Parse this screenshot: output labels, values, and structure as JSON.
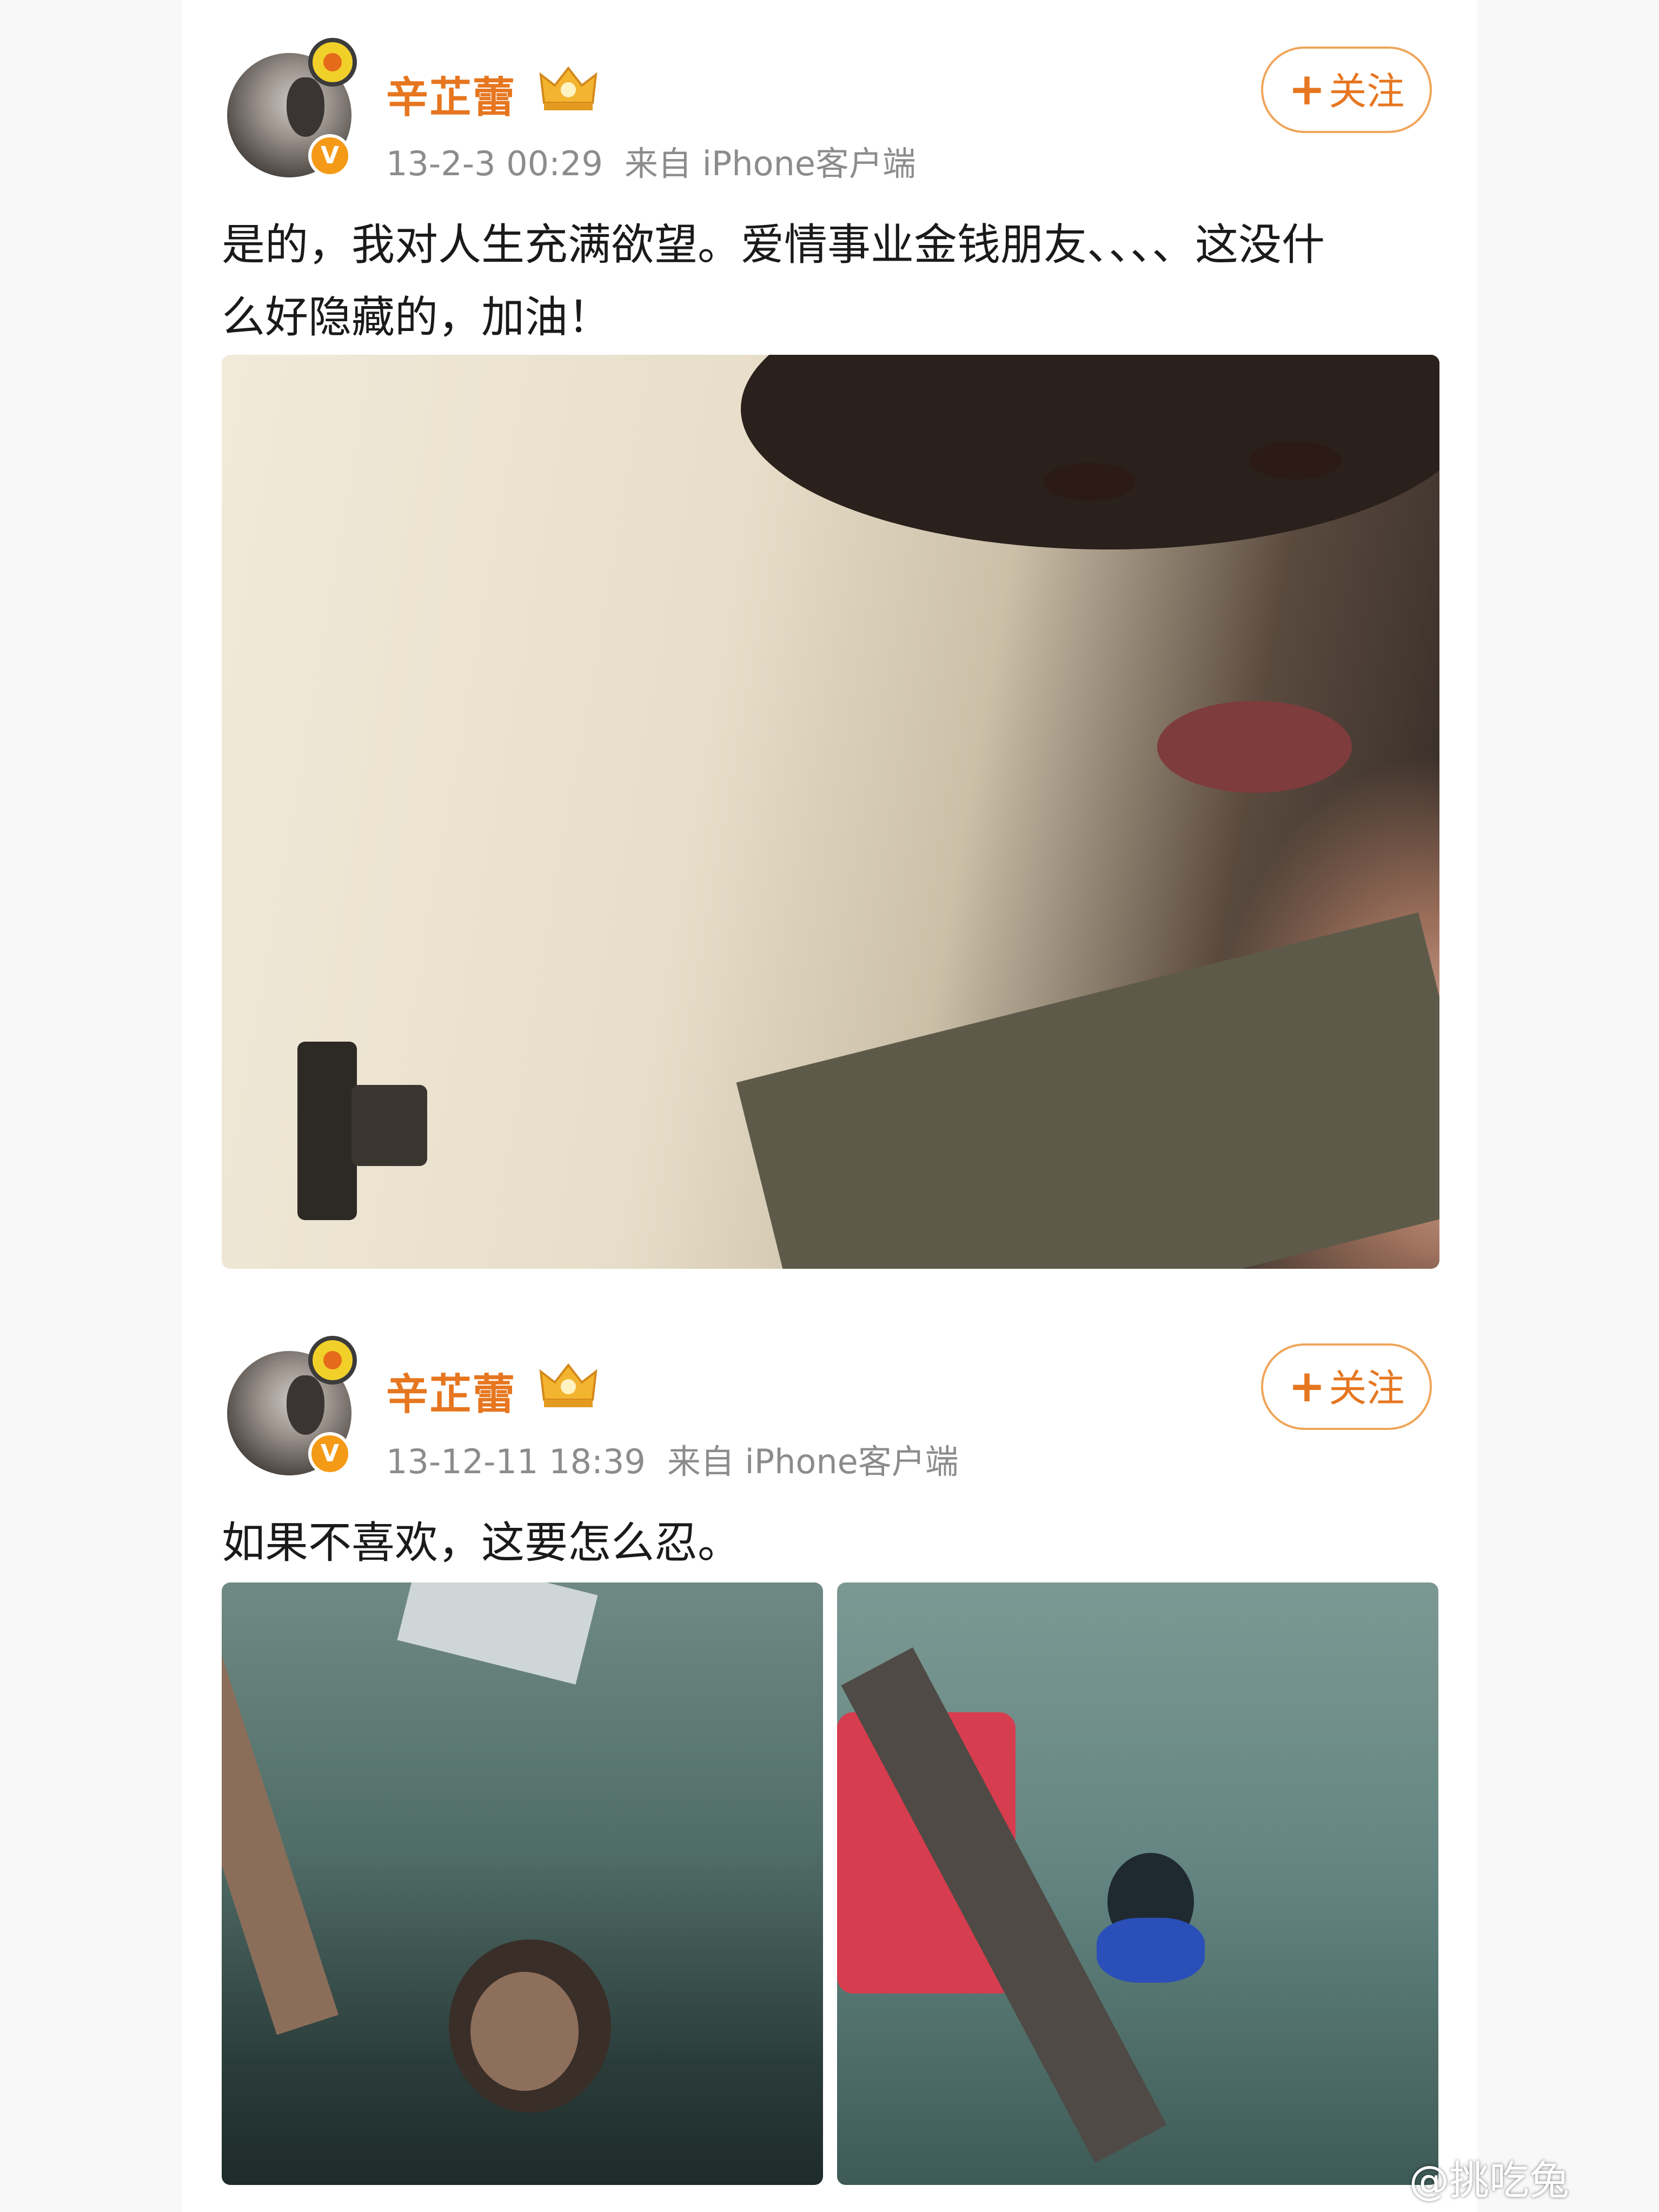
{
  "posts": [
    {
      "author": {
        "name": "辛芷蕾",
        "verified": "V"
      },
      "meta": {
        "time": "13-2-3 00:29",
        "source": "来自 iPhone客户端"
      },
      "follow_label": "关注",
      "follow_icon": "+",
      "text_lines": [
        "是的，我对人生充满欲望。爱情事业金钱朋友、、、、这没什",
        "么好隐藏的，加油！"
      ]
    },
    {
      "author": {
        "name": "辛芷蕾",
        "verified": "V"
      },
      "meta": {
        "time": "13-12-11 18:39",
        "source": "来自 iPhone客户端"
      },
      "follow_label": "关注",
      "follow_icon": "+",
      "text_lines": [
        "如果不喜欢，这要怎么忍。"
      ]
    }
  ],
  "watermark": "@挑吃兔",
  "colors": {
    "accent": "#e6761f",
    "follow_border": "#f0a55a",
    "meta": "#8c8c8c",
    "text": "#1a1a1a"
  }
}
